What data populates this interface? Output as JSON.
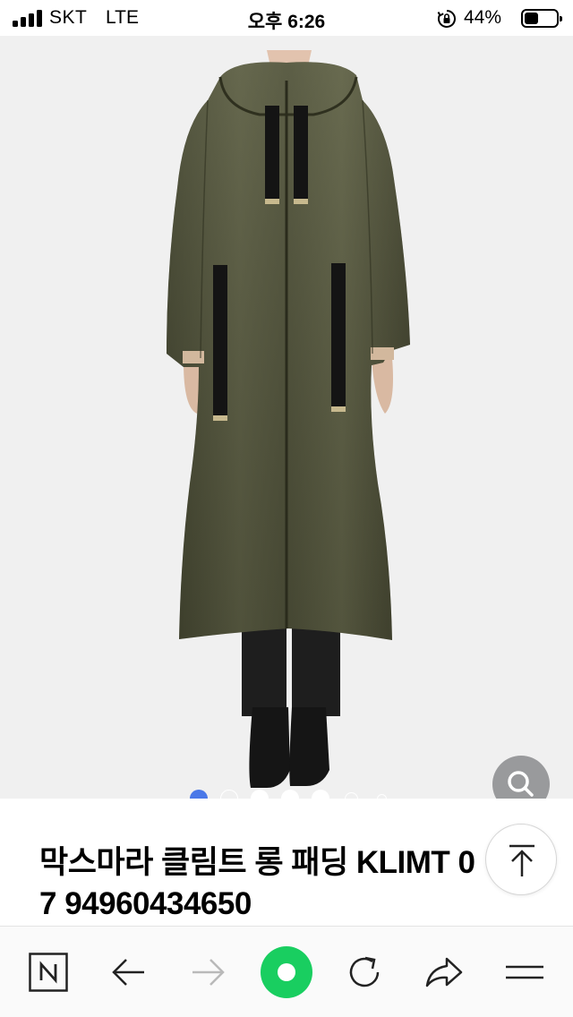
{
  "status_bar": {
    "carrier": "SKT",
    "network": "LTE",
    "time": "오후 6:26",
    "battery_percent": "44%",
    "battery_level": 0.44,
    "icons": [
      "signal-icon",
      "rotation-lock-icon",
      "battery-icon"
    ]
  },
  "gallery": {
    "image_count": 7,
    "active_index": 0,
    "active_color": "#4a78e8",
    "search_button_icon": "search-icon"
  },
  "product": {
    "title_line1": "막스마라 클림트 롱 패딩 KLIMT 0",
    "title_line2": "7 94960434650"
  },
  "scroll_top_button": {
    "icon": "arrow-up-to-top-icon"
  },
  "toolbar": {
    "items": [
      {
        "name": "naver-home",
        "icon": "naver-n-icon"
      },
      {
        "name": "back",
        "icon": "arrow-left-icon"
      },
      {
        "name": "forward",
        "icon": "arrow-right-icon",
        "disabled": true
      },
      {
        "name": "green-dot",
        "icon": "green-circle-icon",
        "color": "#19ce60"
      },
      {
        "name": "refresh",
        "icon": "refresh-icon"
      },
      {
        "name": "share",
        "icon": "share-icon"
      },
      {
        "name": "menu",
        "icon": "menu-icon"
      }
    ]
  }
}
